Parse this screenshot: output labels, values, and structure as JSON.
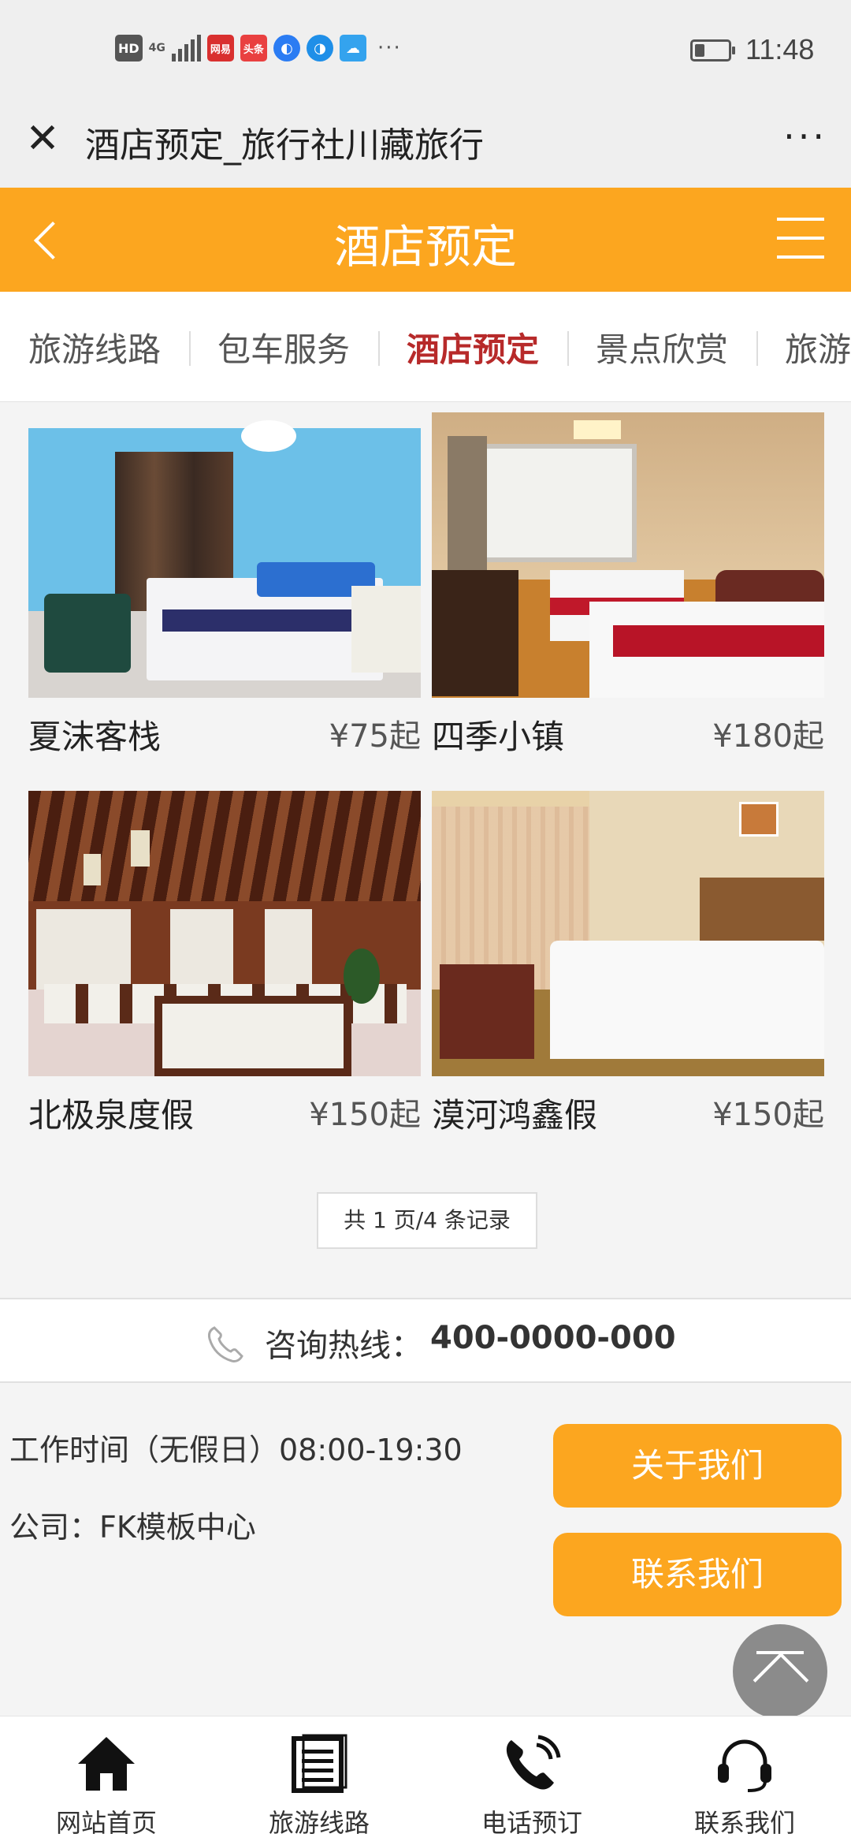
{
  "status_bar": {
    "hd": "HD",
    "network": "4G",
    "app_badge_1": "网易",
    "app_badge_2": "头条",
    "more": "···",
    "time": "11:48",
    "battery_level": 0.3
  },
  "browser": {
    "title": "酒店预定_旅行社川藏旅行",
    "more": "···"
  },
  "header": {
    "title": "酒店预定"
  },
  "categories": [
    {
      "label": "旅游线路",
      "active": false
    },
    {
      "label": "包车服务",
      "active": false
    },
    {
      "label": "酒店预定",
      "active": true
    },
    {
      "label": "景点欣赏",
      "active": false
    },
    {
      "label": "旅游",
      "active": false
    }
  ],
  "hotels": [
    {
      "name": "夏沫客栈",
      "price": "¥75起"
    },
    {
      "name": "四季小镇",
      "price": "¥180起"
    },
    {
      "name": "北极泉度假",
      "price": "¥150起"
    },
    {
      "name": "漠河鸿鑫假",
      "price": "¥150起"
    }
  ],
  "pager": {
    "text": "共 1 页/4 条记录"
  },
  "hotline": {
    "label": "咨询热线：",
    "number": "400-0000-000"
  },
  "footer": {
    "work_time": "工作时间（无假日）08:00-19:30",
    "company": "公司：FK模板中心",
    "about_button": "关于我们",
    "contact_button": "联系我们"
  },
  "bottom_nav": [
    {
      "label": "网站首页",
      "icon": "home-icon"
    },
    {
      "label": "旅游线路",
      "icon": "document-list-icon"
    },
    {
      "label": "电话预订",
      "icon": "phone-call-icon"
    },
    {
      "label": "联系我们",
      "icon": "headset-icon"
    }
  ],
  "colors": {
    "accent": "#fca61f",
    "active_category": "#b72a2a"
  }
}
